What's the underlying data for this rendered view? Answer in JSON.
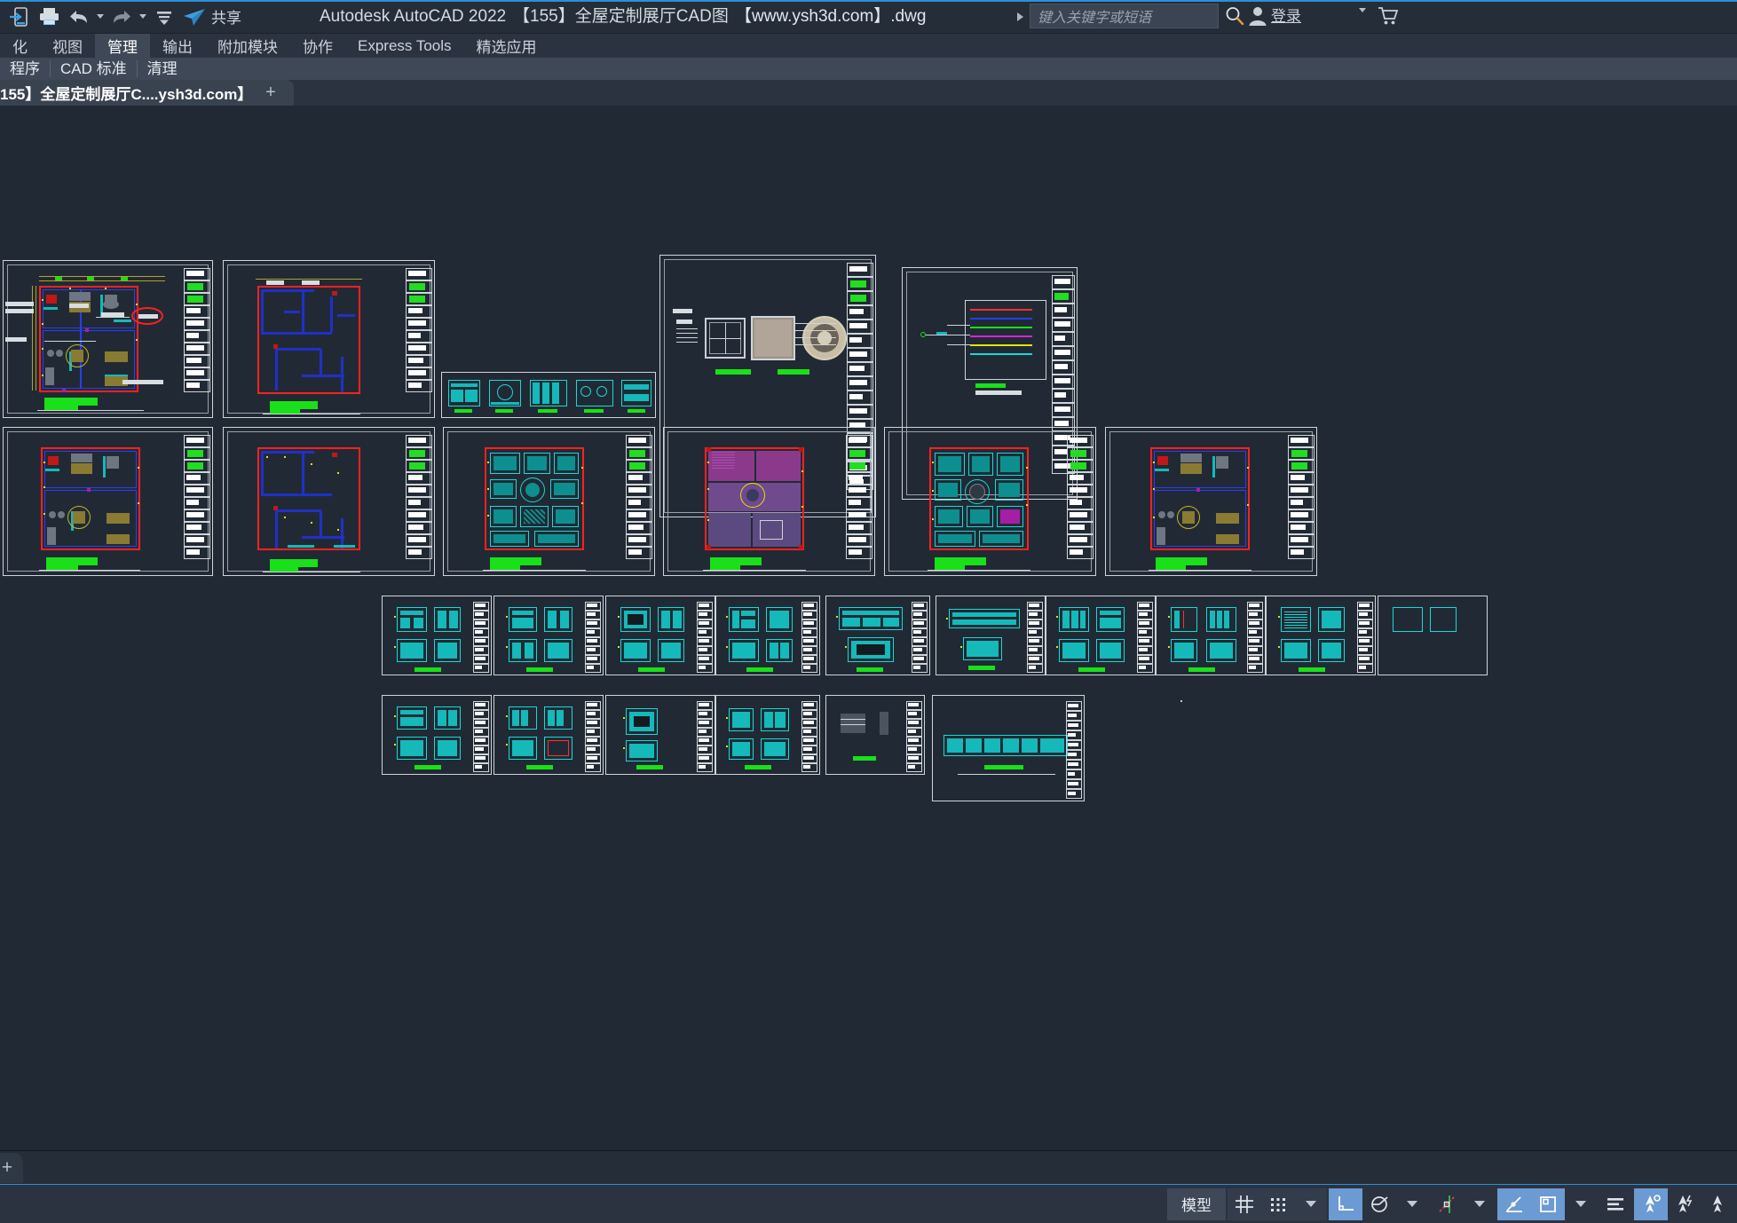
{
  "app": {
    "name": "Autodesk AutoCAD 2022",
    "document_title": "【155】全屋定制展厅CAD图",
    "document_file": "【www.ysh3d.com】.dwg"
  },
  "quick_access": {
    "items": [
      {
        "name": "open-from-mobile-icon",
        "label": ""
      },
      {
        "name": "print-icon",
        "label": ""
      },
      {
        "name": "undo-icon",
        "label": ""
      },
      {
        "name": "undo-dropdown-icon",
        "label": ""
      },
      {
        "name": "redo-icon",
        "label": ""
      },
      {
        "name": "redo-dropdown-icon",
        "label": ""
      },
      {
        "name": "customize-qat-icon",
        "label": ""
      }
    ],
    "share_label": "共享"
  },
  "search": {
    "placeholder": "键入关键字或短语",
    "value": ""
  },
  "account": {
    "sign_in_label": "登录"
  },
  "ribbon": {
    "tabs": [
      {
        "label": "化",
        "active": false
      },
      {
        "label": "视图",
        "active": false
      },
      {
        "label": "管理",
        "active": true
      },
      {
        "label": "输出",
        "active": false
      },
      {
        "label": "附加模块",
        "active": false
      },
      {
        "label": "协作",
        "active": false
      },
      {
        "label": "Express Tools",
        "active": false
      },
      {
        "label": "精选应用",
        "active": false
      }
    ],
    "panels": [
      {
        "label": "程序"
      },
      {
        "label": "CAD 标准"
      },
      {
        "label": "清理"
      }
    ]
  },
  "document_tabs": {
    "tabs": [
      {
        "label": "155】全屋定制展厅C....ysh3d.com】",
        "modified_marker": "*",
        "close_label": "✕",
        "active": true
      }
    ],
    "new_tab_label": "+"
  },
  "model_tabs": {
    "add_label": "+"
  },
  "status_bar": {
    "model_label": "模型",
    "buttons": [
      {
        "name": "grid-display-toggle",
        "label": "",
        "state": "off"
      },
      {
        "name": "snap-mode-toggle",
        "label": "",
        "state": "off"
      },
      {
        "name": "snap-dropdown",
        "label": "",
        "state": "off"
      },
      {
        "name": "ortho-mode-toggle",
        "label": "",
        "state": "on"
      },
      {
        "name": "polar-tracking-toggle",
        "label": "",
        "state": "off"
      },
      {
        "name": "polar-dropdown",
        "label": "",
        "state": "off"
      },
      {
        "name": "object-snap-toggle",
        "label": "",
        "state": "off"
      },
      {
        "name": "osnap-dropdown",
        "label": "",
        "state": "off"
      },
      {
        "name": "object-snap-tracking-toggle",
        "label": "",
        "state": "on"
      },
      {
        "name": "lineweight-toggle",
        "label": "",
        "state": "on"
      },
      {
        "name": "lineweight-dropdown",
        "label": "",
        "state": "off"
      },
      {
        "name": "transparency-toggle",
        "label": "",
        "state": "off"
      },
      {
        "name": "selection-cycling-toggle",
        "label": "",
        "state": "on"
      },
      {
        "name": "annotation-monitor-toggle",
        "label": "",
        "state": "off"
      },
      {
        "name": "annotation-scale-toggle",
        "label": "",
        "state": "off"
      }
    ]
  },
  "drawing": {
    "background_color": "#212a34",
    "description": "AutoCAD model space showing a tiled layout of whole-house custom furniture showroom CAD sheets",
    "sheets": [
      {
        "name": "floor-plan-furniture-layout",
        "row": 1,
        "col": 1
      },
      {
        "name": "floor-plan-dimension",
        "row": 1,
        "col": 2
      },
      {
        "name": "elevation-strip-details",
        "row": 1,
        "col": 3
      },
      {
        "name": "material-sample-board",
        "row": 1,
        "col": 4
      },
      {
        "name": "schematic-diagram",
        "row": 1,
        "col": 5
      },
      {
        "name": "floor-plan-furniture-layout-b",
        "row": 2,
        "col": 1
      },
      {
        "name": "floor-plan-wiring",
        "row": 2,
        "col": 2
      },
      {
        "name": "ceiling-plan",
        "row": 2,
        "col": 3
      },
      {
        "name": "flooring-plan",
        "row": 2,
        "col": 4
      },
      {
        "name": "ceiling-plan-b",
        "row": 2,
        "col": 5
      },
      {
        "name": "floor-plan-furniture-layout-c",
        "row": 2,
        "col": 6
      },
      {
        "name": "elevation-sheet-1",
        "row": 3,
        "col": 1
      },
      {
        "name": "elevation-sheet-2",
        "row": 3,
        "col": 2
      },
      {
        "name": "elevation-sheet-3",
        "row": 3,
        "col": 3
      },
      {
        "name": "elevation-sheet-4",
        "row": 3,
        "col": 4
      },
      {
        "name": "elevation-sheet-5",
        "row": 3,
        "col": 5
      },
      {
        "name": "elevation-sheet-6",
        "row": 3,
        "col": 6
      },
      {
        "name": "elevation-sheet-7",
        "row": 3,
        "col": 7
      },
      {
        "name": "elevation-sheet-8",
        "row": 3,
        "col": 8
      },
      {
        "name": "elevation-sheet-9",
        "row": 3,
        "col": 9
      },
      {
        "name": "elevation-sheet-10",
        "row": 4,
        "col": 1
      },
      {
        "name": "elevation-sheet-11",
        "row": 4,
        "col": 2
      },
      {
        "name": "elevation-sheet-12",
        "row": 4,
        "col": 3
      },
      {
        "name": "elevation-sheet-13",
        "row": 4,
        "col": 4
      },
      {
        "name": "elevation-sheet-14",
        "row": 4,
        "col": 5
      },
      {
        "name": "long-elevation-sheet",
        "row": 4,
        "col": 6
      }
    ]
  },
  "colors": {
    "accent": "#2b8fd8",
    "titlebar_bg": "#252d39",
    "ribbon_bg": "#2b3340",
    "panel_bg": "#3e4856",
    "canvas_bg": "#212a34",
    "status_on": "#6b9bd2",
    "cad_red": "#ff2020",
    "cad_blue": "#2a3cff",
    "cad_cyan": "#16d9d9",
    "cad_yellow": "#e2e20f",
    "cad_green": "#19e019",
    "cad_magenta": "#d426d4",
    "cad_white": "#d8dde2"
  }
}
